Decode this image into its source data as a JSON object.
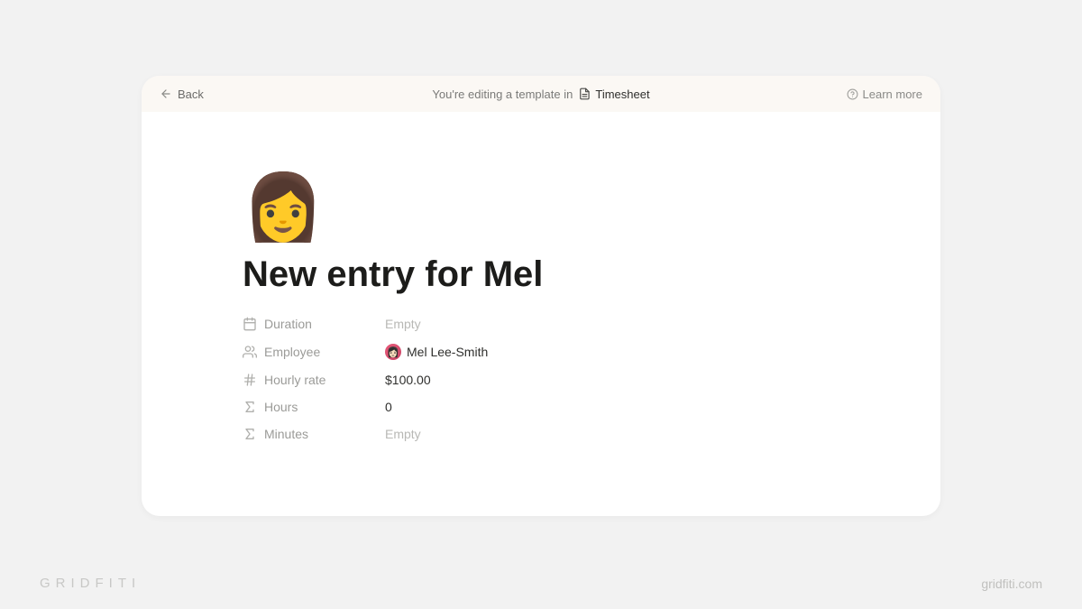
{
  "topbar": {
    "back_label": "Back",
    "editing_text": "You're editing a template in",
    "template_name": "Timesheet",
    "learn_more_label": "Learn more"
  },
  "page": {
    "emoji": "👩",
    "title": "New entry for Mel"
  },
  "properties": [
    {
      "icon": "date",
      "label": "Duration",
      "value": "Empty",
      "empty": true
    },
    {
      "icon": "person",
      "label": "Employee",
      "value": "Mel Lee-Smith",
      "empty": false,
      "avatar": true
    },
    {
      "icon": "hash",
      "label": "Hourly rate",
      "value": "$100.00",
      "empty": false
    },
    {
      "icon": "sigma",
      "label": "Hours",
      "value": "0",
      "empty": false
    },
    {
      "icon": "sigma",
      "label": "Minutes",
      "value": "Empty",
      "empty": true
    }
  ],
  "footer": {
    "brand": "GRIDFITI",
    "url": "gridfiti.com"
  }
}
